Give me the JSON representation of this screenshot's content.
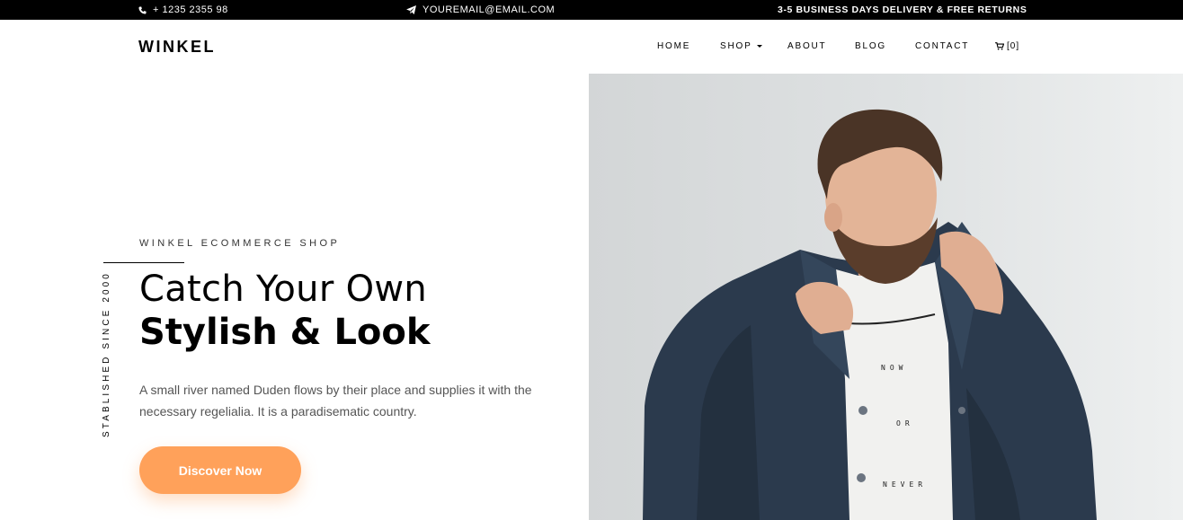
{
  "topbar": {
    "phone": "+ 1235 2355 98",
    "email": "YOUREMAIL@EMAIL.COM",
    "delivery": "3-5 BUSINESS DAYS DELIVERY & FREE RETURNS"
  },
  "navbar": {
    "brand": "WINKEL",
    "links": {
      "home": "HOME",
      "shop": "SHOP",
      "about": "ABOUT",
      "blog": "BLOG",
      "contact": "CONTACT",
      "cart": "[0]"
    }
  },
  "hero": {
    "subheading": "WINKEL ECOMMERCE SHOP",
    "vertical_text": "STABLISHED SINCE 2000",
    "title_line1": "Catch Your Own",
    "title_line2": "Stylish & Look",
    "description": "A small river named Duden flows by their place and supplies it with the necessary regelialia. It is a paradisematic country.",
    "button_label": "Discover Now",
    "shirt_text": [
      "NOW",
      "OR",
      "NEVER"
    ]
  },
  "colors": {
    "topbar_bg": "#000000",
    "accent": "#ffa15a",
    "photo_bg": "#dfe2e3",
    "jacket": "#2b3a4d"
  },
  "icons": {
    "phone": "phone-icon",
    "email": "paper-plane-icon",
    "cart": "cart-icon",
    "dropdown": "caret-down-icon"
  }
}
